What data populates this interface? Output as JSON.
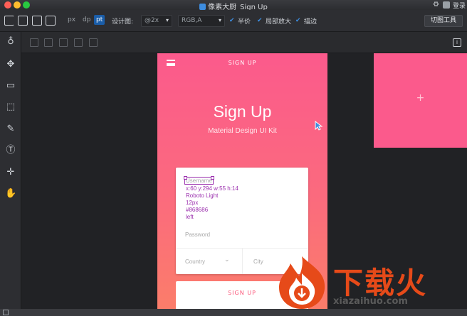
{
  "window": {
    "title": "像素大厨_Sign Up",
    "login_label": "登录"
  },
  "toolbar": {
    "unit_px": "px",
    "unit_dp": "dp",
    "unit_pt": "pt",
    "design_label": "设计图:",
    "scale_value": "@2x",
    "color_mode_value": "RGB,A",
    "check_half": "半价",
    "check_local_zoom": "局部放大",
    "check_stroke": "描边",
    "cut_tool_label": "切图工具"
  },
  "artboard": {
    "header": "SIGN UP",
    "title": "Sign Up",
    "subtitle": "Material Design UI Kit",
    "username_placeholder": "Username",
    "inspect_lines": [
      "x:60 y:294 w:55 h:14",
      "Roboto Light",
      "12px",
      "#868686",
      "left"
    ],
    "password_placeholder": "Password",
    "country_placeholder": "Country",
    "city_placeholder": "City",
    "button_label": "SIGN UP"
  },
  "watermark": {
    "logo_text": "下载火",
    "url": "xiazaihuo.com"
  },
  "colors": {
    "accent_pink": "#fb5a8c",
    "inspect_purple": "#9b2fae",
    "toolbar_bg": "#2d2e32",
    "canvas_bg": "#212225"
  },
  "icons": [
    "add-artboard-icon",
    "folder-icon",
    "save-icon",
    "export-icon",
    "gear-icon",
    "avatar-icon",
    "info-icon",
    "hint-icon",
    "move-icon",
    "ruler-icon",
    "marquee-icon",
    "eyedropper-icon",
    "text-icon",
    "crosshair-icon",
    "hand-icon"
  ]
}
